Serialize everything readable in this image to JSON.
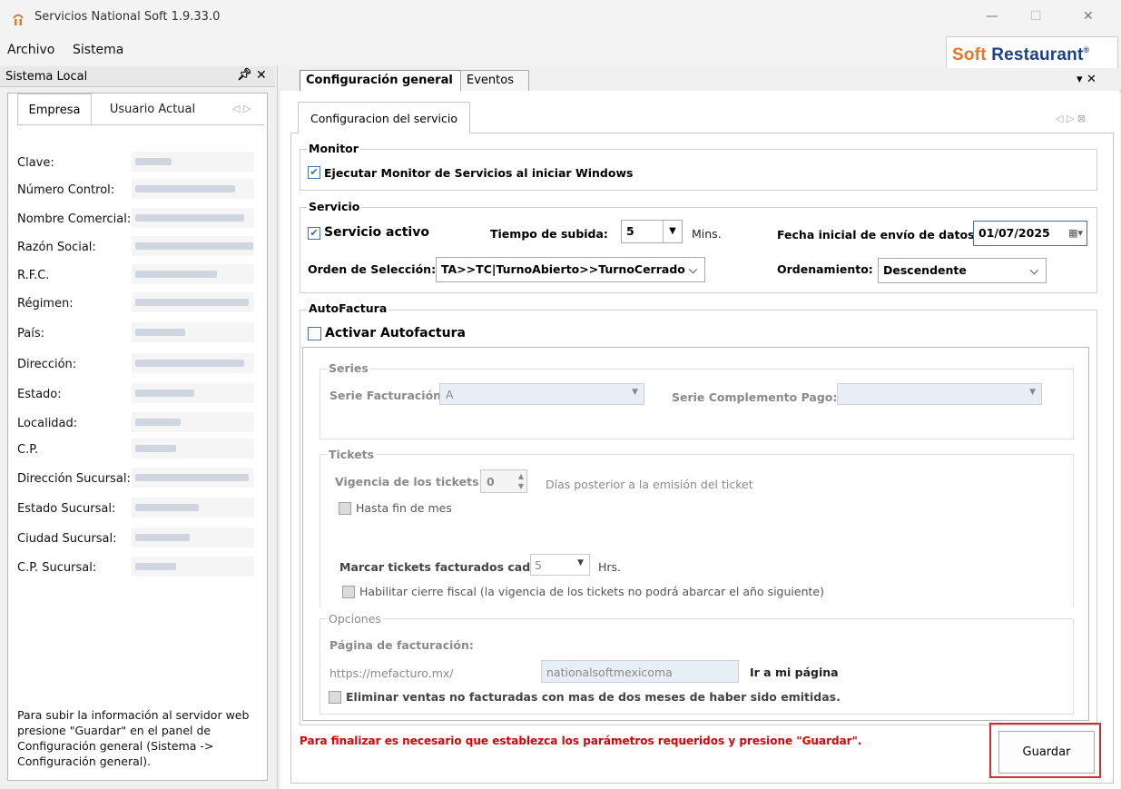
{
  "window": {
    "title": "Servicios National Soft 1.9.33.0",
    "minimize": "—",
    "maximize": "☐",
    "close": "✕"
  },
  "menu": [
    "Archivo",
    "Sistema"
  ],
  "logo": {
    "soft": "Soft ",
    "restaurant": "Restaurant",
    "reg": "®"
  },
  "left_panel": {
    "title": "Sistema Local",
    "pin": "ᵖ",
    "close": "✕",
    "tabs": [
      "Empresa",
      "Usuario Actual"
    ],
    "nav": "◁ ▷",
    "fields": [
      {
        "label": "Clave:"
      },
      {
        "label": "Número Control:"
      },
      {
        "label": "Nombre Comercial:"
      },
      {
        "label": "Razón Social:"
      },
      {
        "label": "R.F.C."
      },
      {
        "label": "Régimen:"
      },
      {
        "label": "País:"
      },
      {
        "label": "Dirección:"
      },
      {
        "label": "Estado:"
      },
      {
        "label": "Localidad:"
      },
      {
        "label": "C.P."
      },
      {
        "label": "Dirección Sucursal:"
      },
      {
        "label": "Estado Sucursal:"
      },
      {
        "label": "Ciudad Sucursal:"
      },
      {
        "label": "C.P. Sucursal:"
      }
    ],
    "note": "Para subir la información al servidor web presione \"Guardar\" en el panel de Configuración general (Sistema -> Configuración general)."
  },
  "main_tabs": {
    "config": "Configuración general",
    "eventos": "Eventos",
    "controls": "▾ ✕"
  },
  "sub_tab": {
    "label": "Configuracion del servicio",
    "nav": "◁ ▷ ⊠"
  },
  "monitor": {
    "title": "Monitor",
    "run_label": "Ejecutar Monitor de Servicios al iniciar Windows",
    "run_checked": true
  },
  "servicio": {
    "title": "Servicio",
    "active_label": "Servicio activo",
    "active_checked": true,
    "upload_label": "Tiempo de subida:",
    "upload_value": "5",
    "upload_unit": "Mins.",
    "date_label": "Fecha inicial de envío de datos:",
    "date_value": "01/07/2025",
    "order_label": "Orden de Selección:",
    "order_value": "TA>>TC|TurnoAbierto>>TurnoCerrado",
    "sort_label": "Ordenamiento:",
    "sort_value": "Descendente"
  },
  "autofactura": {
    "title": "AutoFactura",
    "activate_label": "Activar Autofactura",
    "activate_checked": false,
    "series": {
      "title": "Series",
      "billing_label": "Serie Facturación:",
      "billing_value": "A",
      "complement_label": "Serie Complemento Pago:",
      "complement_value": ""
    },
    "tickets": {
      "title": "Tickets",
      "validity_label": "Vigencia de los tickets:",
      "validity_value": "0",
      "validity_note": "Días posterior a la emisión del ticket",
      "month_end_label": "Hasta fin de mes",
      "mark_label": "Marcar tickets facturados cada:",
      "mark_value": "5",
      "mark_unit": "Hrs.",
      "fiscal_label": "Habilitar cierre fiscal (la vigencia de los tickets no podrá abarcar el año siguiente)"
    },
    "opciones": {
      "title": "Opciones",
      "page_label": "Página de facturación:",
      "url_prefix": "https://mefacturo.mx/",
      "url_value": "nationalsoftmexicoma",
      "link": "Ir a mi página",
      "delete_label": "Eliminar ventas no facturadas con mas de dos meses de haber sido emitidas."
    }
  },
  "footer": {
    "message": "Para finalizar es necesario que establezca los parámetros requeridos y presione \"Guardar\".",
    "save_label": "Guardar"
  },
  "colors": {
    "accent_blue": "#2f6fb5",
    "logo_orange": "#e4772a",
    "logo_blue": "#1d3f8a",
    "error_red": "#e00000",
    "highlight_red": "#d32f2f"
  }
}
